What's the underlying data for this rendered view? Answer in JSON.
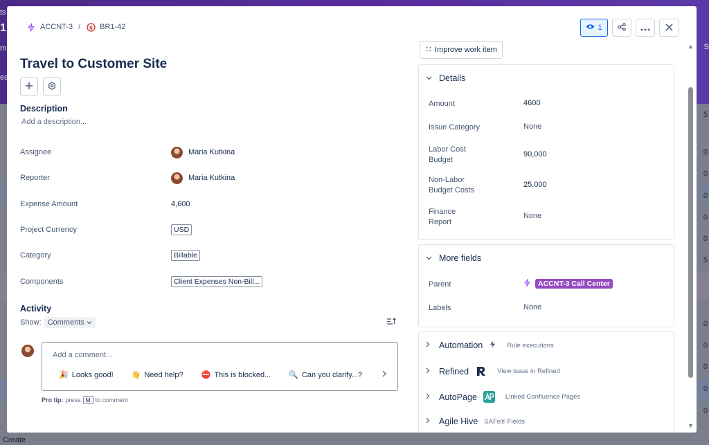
{
  "background": {
    "left_fragments": [
      "ts",
      "1",
      "m",
      "ea"
    ],
    "right_fragments": [
      "S",
      "5",
      "0",
      "0",
      "0",
      "0",
      "0",
      "5",
      "0",
      "0",
      "0",
      "0",
      "0"
    ],
    "create_label": "Create"
  },
  "breadcrumb": {
    "parent_key": "ACCNT-3",
    "separator": "/",
    "item_key": "BR1-42"
  },
  "header": {
    "watch_count": "1",
    "watch_icon": "eye-icon",
    "share_icon": "share-icon",
    "more_icon": "more-icon",
    "close_icon": "close-icon"
  },
  "issue": {
    "title": "Travel to Customer Site",
    "add_icon": "plus-icon",
    "apps_icon": "apps-icon"
  },
  "description": {
    "heading": "Description",
    "placeholder": "Add a description..."
  },
  "fields": [
    {
      "label": "Assignee",
      "value": "Maria Kutkina",
      "kind": "user"
    },
    {
      "label": "Reporter",
      "value": "Maria Kutkina",
      "kind": "user"
    },
    {
      "label": "Expense Amount",
      "value": "4,600",
      "kind": "text"
    },
    {
      "label": "Project Currency",
      "value": "USD",
      "kind": "tag"
    },
    {
      "label": "Category",
      "value": "Billable",
      "kind": "tag"
    },
    {
      "label": "Components",
      "value": "Client Expenses Non-Bill...",
      "kind": "tag"
    }
  ],
  "activity": {
    "heading": "Activity",
    "show_label": "Show:",
    "show_value": "Comments",
    "comment_placeholder": "Add a comment...",
    "quick_replies": [
      {
        "emoji": "🎉",
        "label": "Looks good!"
      },
      {
        "emoji": "👋",
        "label": "Need help?"
      },
      {
        "emoji": "⛔",
        "label": "This is blocked..."
      },
      {
        "emoji": "🔍",
        "label": "Can you clarify...?"
      }
    ],
    "protip_prefix": "Pro tip:",
    "protip_press": "press",
    "protip_key": "M",
    "protip_suffix": "to comment"
  },
  "improve": {
    "label": "Improve work item"
  },
  "details": {
    "heading": "Details",
    "rows": [
      {
        "label": "Amount",
        "value": "4600"
      },
      {
        "label": "Issue Category",
        "value": "None"
      },
      {
        "label": "Labor Cost\nBudget",
        "value": "90,000"
      },
      {
        "label": "Non-Labor\nBudget Costs",
        "value": "25,000"
      },
      {
        "label": "Finance\nReport",
        "value": "None"
      }
    ]
  },
  "more_fields": {
    "heading": "More fields",
    "parent_label": "Parent",
    "parent_value": "ACCNT-3 Call Center",
    "labels_label": "Labels",
    "labels_value": "None"
  },
  "apps": [
    {
      "name": "Automation",
      "sub": "Rule executions",
      "icon": "lightning-icon",
      "color": "#44546f"
    },
    {
      "name": "Refined",
      "sub": "View issue in Refined",
      "icon": "refined-logo-icon",
      "color": "#1d2b4f"
    },
    {
      "name": "AutoPage",
      "sub": "Linked Confluence Pages",
      "icon": "autopage-logo-icon",
      "color": "#2aa198"
    },
    {
      "name": "Agile Hive",
      "sub": "SAFe® Fields",
      "icon": "",
      "color": ""
    }
  ]
}
